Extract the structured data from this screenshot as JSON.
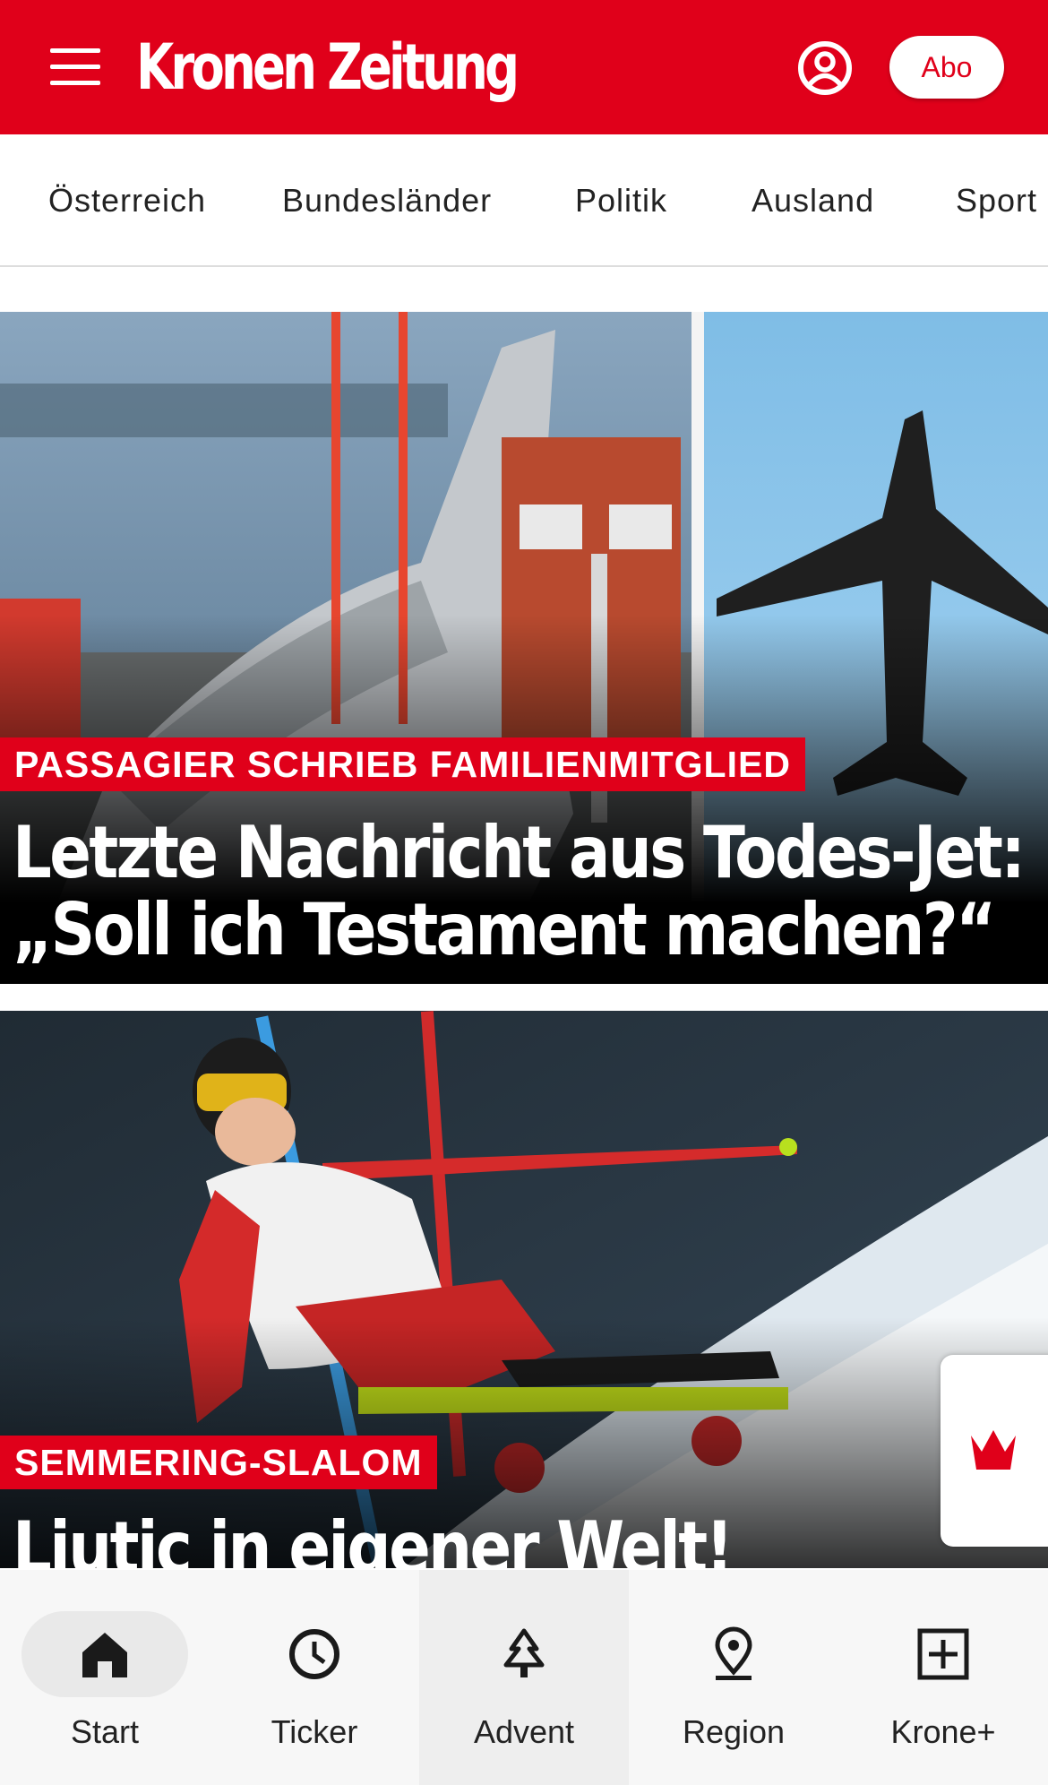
{
  "header": {
    "logo_text": "Kronen Zeitung",
    "abo_label": "Abo",
    "menu_icon": "hamburger-menu-icon",
    "account_icon": "user-account-icon",
    "brand_color": "#e0001a"
  },
  "nav": {
    "items": [
      "Österreich",
      "Bundesländer",
      "Politik",
      "Ausland",
      "Sport"
    ]
  },
  "articles": [
    {
      "kicker": "PASSAGIER SCHRIEB FAMILIENMITGLIED",
      "headline_line1": "Letzte Nachricht aus Todes-Jet:",
      "headline_line2": "„Soll ich Testament machen?“"
    },
    {
      "kicker": "SEMMERING-SLALOM",
      "headline_line1": "Ljutic in eigener Welt!"
    }
  ],
  "floating": {
    "icon": "krone-crown-icon"
  },
  "bottom_nav": {
    "items": [
      {
        "label": "Start",
        "icon": "home-icon"
      },
      {
        "label": "Ticker",
        "icon": "clock-icon"
      },
      {
        "label": "Advent",
        "icon": "christmas-tree-icon"
      },
      {
        "label": "Region",
        "icon": "location-pin-icon"
      },
      {
        "label": "Krone+",
        "icon": "plus-box-icon"
      }
    ]
  }
}
